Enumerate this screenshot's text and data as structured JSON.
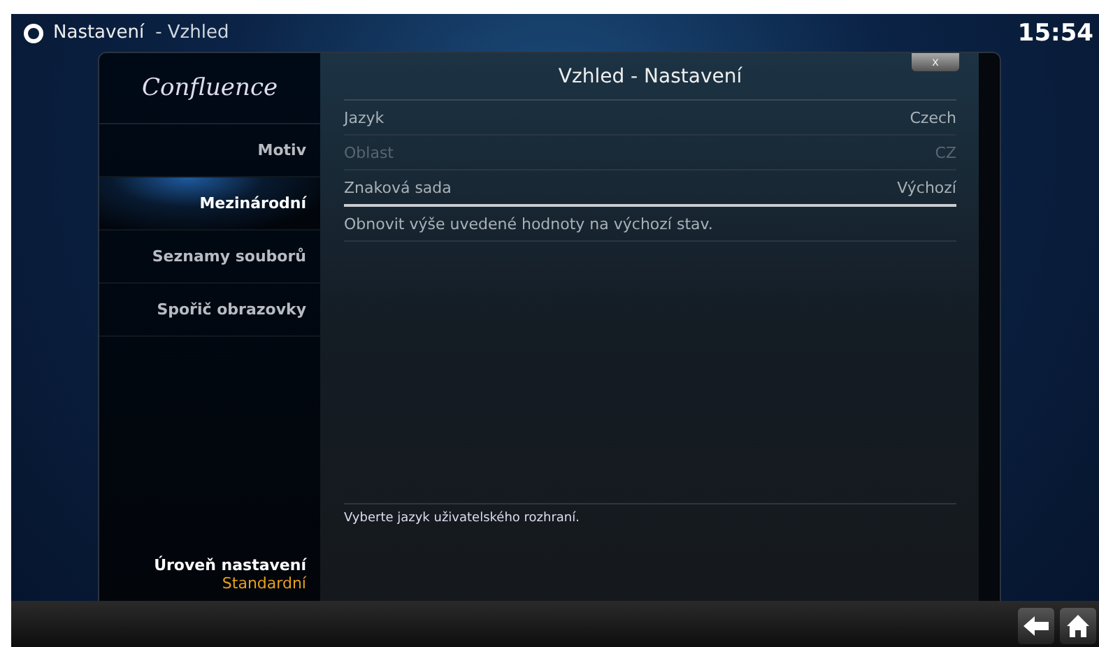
{
  "header": {
    "title": "Nastavení",
    "subtitle": "- Vzhled",
    "clock": "15:54"
  },
  "dialog": {
    "logo": "Confluence",
    "title": "Vzhled - Nastavení",
    "close": "x"
  },
  "sidebar": {
    "items": [
      {
        "label": "Motiv",
        "selected": false
      },
      {
        "label": "Mezinárodní",
        "selected": true
      },
      {
        "label": "Seznamy souborů",
        "selected": false
      },
      {
        "label": "Spořič obrazovky",
        "selected": false
      }
    ],
    "level_label": "Úroveň nastavení",
    "level_value": "Standardní"
  },
  "settings": [
    {
      "label": "Jazyk",
      "value": "Czech",
      "disabled": false,
      "focused": false
    },
    {
      "label": "Oblast",
      "value": "CZ",
      "disabled": true,
      "focused": false
    },
    {
      "label": "Znaková sada",
      "value": "Výchozí",
      "disabled": false,
      "focused": true
    },
    {
      "label": "Obnovit výše uvedené hodnoty na výchozí stav.",
      "disabled": false,
      "focused": false
    }
  ],
  "description": "Vyberte jazyk uživatelského rozhraní."
}
